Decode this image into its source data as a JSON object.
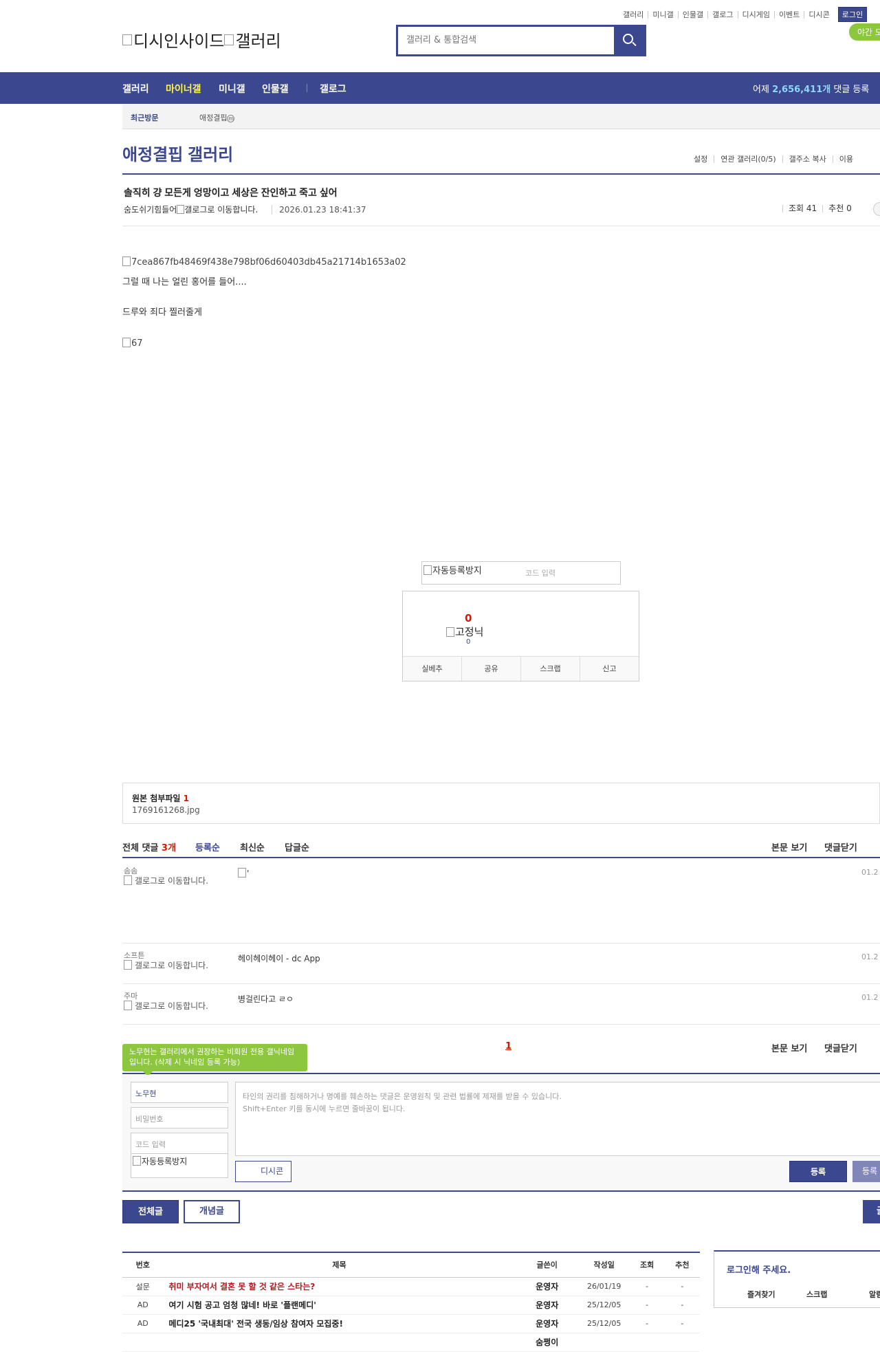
{
  "top_links": [
    "갤러리",
    "미니갤",
    "인물갤",
    "갤로그",
    "디시게임",
    "이벤트",
    "디시콘"
  ],
  "login_label": "로그인",
  "night_mode_label": "야간 모",
  "logo": {
    "site": "디시인사이드",
    "gallery": "갤러리"
  },
  "search": {
    "placeholder": "갤러리 & 통합검색"
  },
  "nav": {
    "items": [
      "갤러리",
      "마이너갤",
      "미니갤",
      "인물갤",
      "갤로그"
    ],
    "active_index": 1,
    "stats_prefix": "어제",
    "stats_count": "2,656,411개",
    "stats_suffix": "댓글 등록"
  },
  "recent": {
    "label": "최근방문",
    "item": "애정결핍",
    "item_badge": "m"
  },
  "gallery": {
    "title": "애정결핍 갤러리",
    "tools": [
      "설정",
      "연관 갤러리(0/5)",
      "갤주소 복사",
      "이용"
    ]
  },
  "post": {
    "title": "솔직히 걍 모든게 엉망이고 세상은 잔인하고 죽고 싶어",
    "author": "숨도쉬기힘들어",
    "gallog_alt": "갤로그로 이동합니다.",
    "date": "2026.01.23 18:41:37",
    "views": "조회 41",
    "recommend": "추천 0",
    "image1_alt": "7cea867fb48469f438e798bf06d60403db45a21714b1653a02",
    "line1": "그럴 때 나는 얼린 홍어를 들어....",
    "line2": "드루와 죄다 찔러줄게",
    "image2_alt": "67"
  },
  "recommend_box": {
    "captcha_alt": "자동등록방지",
    "captcha_placeholder": "코드 입력",
    "count": "0",
    "fixed_alt": "고정닉",
    "fixed_count": "0",
    "buttons": [
      "실베추",
      "공유",
      "스크랩",
      "신고"
    ]
  },
  "attachment": {
    "title": "원본 첨부파일",
    "count": "1",
    "file": "1769161268.jpg"
  },
  "comments_header": {
    "all_label": "전체 댓글",
    "count": "3개",
    "sorts": [
      "등록순",
      "최신순",
      "답글순"
    ],
    "right": [
      "본문 보기",
      "댓글닫기"
    ]
  },
  "comments": [
    {
      "nick": "솜솜",
      "gallog_alt": "갤로그로 이동합니다.",
      "text": "'",
      "date": "01.2"
    },
    {
      "nick": "소프튼",
      "gallog_alt": "갤로그로 이동합니다.",
      "text": "헤이헤이헤이 - dc App",
      "date": "01.2"
    },
    {
      "nick": "주마",
      "gallog_alt": "갤로그로 이동합니다.",
      "text": "병걸린다고 ㄹㅇ",
      "date": "01.2"
    }
  ],
  "pagination": {
    "current": "1",
    "right": [
      "본문 보기",
      "댓글닫기"
    ]
  },
  "write_form": {
    "tooltip": "노무현는 갤러리에서 권장하는 비회원 전용 갤닉네임입니다. (삭제 시 닉네임 등록 가능)",
    "name_value": "노무현",
    "password_placeholder": "비밀번호",
    "code_placeholder": "코드 입력",
    "captcha_alt": "자동등록방지",
    "textarea_line1": "타인의 권리를 침해하거나 명예를 훼손하는 댓글은 운영원칙 및 관련 법률에 제재를 받을 수 있습니다.",
    "textarea_line2": "Shift+Enter 키를 동시에 누르면 줄바꿈이 됩니다.",
    "dccon_label": "디시콘",
    "submit_label": "등록",
    "submit2_label": "등록"
  },
  "list_buttons": {
    "all": "전체글",
    "concept": "개념글",
    "write": "글"
  },
  "table": {
    "headers": [
      "번호",
      "제목",
      "글쓴이",
      "작성일",
      "조회",
      "추천"
    ],
    "rows": [
      {
        "no": "설문",
        "title": "취미 부자여서 결혼 못 할 것 같은 스타는?",
        "writer": "운영자",
        "date": "26/01/19",
        "views": "-",
        "rec": "-",
        "red": true
      },
      {
        "no": "AD",
        "title": "여기 시험 공고 엄청 많네! 바로 '플랜메디'",
        "writer": "운영자",
        "date": "25/12/05",
        "views": "-",
        "rec": "-",
        "red": false
      },
      {
        "no": "AD",
        "title": "메디25 '국내최대' 전국 생동/임상 참여자 모집중!",
        "writer": "운영자",
        "date": "25/12/05",
        "views": "-",
        "rec": "-",
        "red": false
      },
      {
        "no": "",
        "title": "",
        "writer": "숨쩡이",
        "date": "",
        "views": "",
        "rec": "",
        "red": false
      }
    ]
  },
  "login_box": {
    "title": "로그인해 주세요.",
    "links": [
      "즐겨찾기",
      "스크랩",
      "알림"
    ]
  }
}
